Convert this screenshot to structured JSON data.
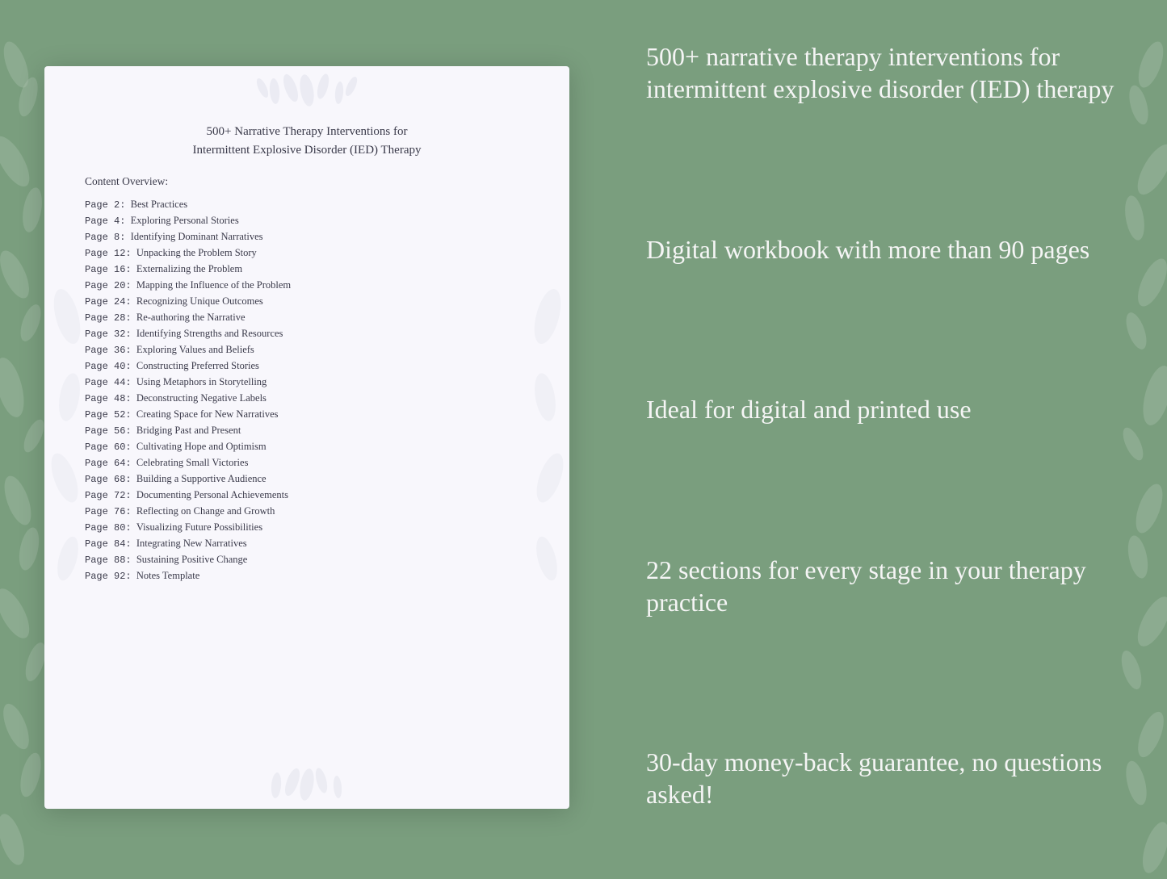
{
  "background": {
    "color": "#7a9e7e"
  },
  "document": {
    "title_line1": "500+ Narrative Therapy Interventions for",
    "title_line2": "Intermittent Explosive Disorder (IED) Therapy",
    "content_overview_label": "Content Overview:",
    "toc": [
      {
        "page": "Page  2:",
        "title": "Best Practices"
      },
      {
        "page": "Page  4:",
        "title": "Exploring Personal Stories"
      },
      {
        "page": "Page  8:",
        "title": "Identifying Dominant Narratives"
      },
      {
        "page": "Page 12:",
        "title": "Unpacking the Problem Story"
      },
      {
        "page": "Page 16:",
        "title": "Externalizing the Problem"
      },
      {
        "page": "Page 20:",
        "title": "Mapping the Influence of the Problem"
      },
      {
        "page": "Page 24:",
        "title": "Recognizing Unique Outcomes"
      },
      {
        "page": "Page 28:",
        "title": "Re-authoring the Narrative"
      },
      {
        "page": "Page 32:",
        "title": "Identifying Strengths and Resources"
      },
      {
        "page": "Page 36:",
        "title": "Exploring Values and Beliefs"
      },
      {
        "page": "Page 40:",
        "title": "Constructing Preferred Stories"
      },
      {
        "page": "Page 44:",
        "title": "Using Metaphors in Storytelling"
      },
      {
        "page": "Page 48:",
        "title": "Deconstructing Negative Labels"
      },
      {
        "page": "Page 52:",
        "title": "Creating Space for New Narratives"
      },
      {
        "page": "Page 56:",
        "title": "Bridging Past and Present"
      },
      {
        "page": "Page 60:",
        "title": "Cultivating Hope and Optimism"
      },
      {
        "page": "Page 64:",
        "title": "Celebrating Small Victories"
      },
      {
        "page": "Page 68:",
        "title": "Building a Supportive Audience"
      },
      {
        "page": "Page 72:",
        "title": "Documenting Personal Achievements"
      },
      {
        "page": "Page 76:",
        "title": "Reflecting on Change and Growth"
      },
      {
        "page": "Page 80:",
        "title": "Visualizing Future Possibilities"
      },
      {
        "page": "Page 84:",
        "title": "Integrating New Narratives"
      },
      {
        "page": "Page 88:",
        "title": "Sustaining Positive Change"
      },
      {
        "page": "Page 92:",
        "title": "Notes Template"
      }
    ]
  },
  "features": [
    {
      "text": "500+ narrative therapy interventions for intermittent explosive disorder (IED) therapy"
    },
    {
      "text": "Digital workbook with more than 90 pages"
    },
    {
      "text": "Ideal for digital and printed use"
    },
    {
      "text": "22 sections for every stage in your therapy practice"
    },
    {
      "text": "30-day money-back guarantee, no questions asked!"
    }
  ]
}
